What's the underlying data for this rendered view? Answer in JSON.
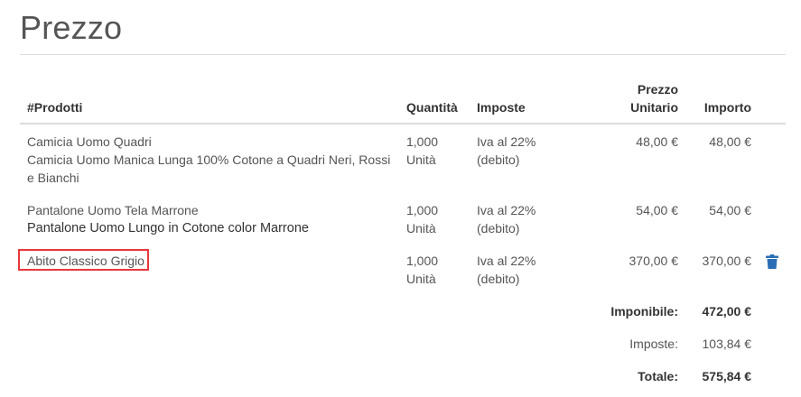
{
  "page": {
    "title": "Prezzo"
  },
  "table": {
    "headers": {
      "products": "#Prodotti",
      "quantity": "Quantità",
      "taxes": "Imposte",
      "unit_price_line1": "Prezzo",
      "unit_price_line2": "Unitario",
      "amount": "Importo"
    },
    "rows": [
      {
        "name": "Camicia Uomo Quadri",
        "description": "Camicia Uomo Manica Lunga 100% Cotone a Quadri Neri, Rossi e Bianchi",
        "quantity": "1,000",
        "unit": "Unità",
        "tax": "Iva al 22%",
        "tax_note": "(debito)",
        "unit_price": "48,00 €",
        "amount": "48,00 €"
      },
      {
        "name": "Pantalone Uomo Tela Marrone",
        "description": "Pantalone Uomo Lungo in Cotone color Marrone",
        "quantity": "1,000",
        "unit": "Unità",
        "tax": "Iva al 22%",
        "tax_note": "(debito)",
        "unit_price": "54,00 €",
        "amount": "54,00 €"
      },
      {
        "name": "Abito Classico Grigio",
        "quantity": "1,000",
        "unit": "Unità",
        "tax": "Iva al 22%",
        "tax_note": "(debito)",
        "unit_price": "370,00 €",
        "amount": "370,00 €",
        "delete_icon": "trash-icon"
      }
    ]
  },
  "summary": {
    "taxable_label": "Imponibile:",
    "taxable_value": "472,00 €",
    "taxes_label": "Imposte:",
    "taxes_value": "103,84 €",
    "total_label": "Totale:",
    "total_value": "575,84 €"
  },
  "colors": {
    "highlight": "#e8383d",
    "trash_icon": "#2a6fb6",
    "rule": "#dddddd"
  }
}
